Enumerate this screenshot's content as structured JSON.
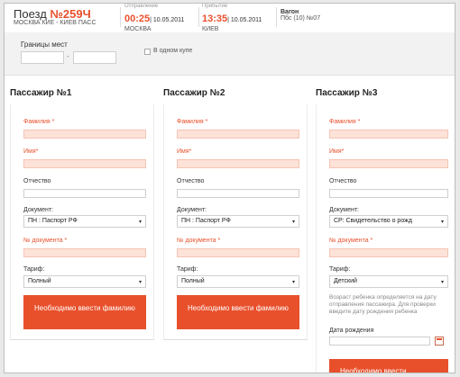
{
  "train": {
    "label": "Поезд",
    "number": "№259Ч",
    "route": "МОСКВА КИЕ - КИЕВ ПАСС"
  },
  "departure": {
    "label": "Отправление",
    "time": "00:25",
    "date": "| 10.05.2011",
    "city": "МОСКВА"
  },
  "arrival": {
    "label": "Прибытие",
    "time": "13:35",
    "date": "| 10.05.2011",
    "city": "КИЕВ"
  },
  "wagon": {
    "label": "Вагон",
    "value": "Пбс (10) №07"
  },
  "filters": {
    "seat_range_label": "Границы мест",
    "separator": "-",
    "same_compartment_label": "В одном купе"
  },
  "passengers": [
    {
      "title": "Пассажир №1",
      "surname_label": "Фамилия *",
      "name_label": "Имя*",
      "patronymic_label": "Отчество",
      "document_label": "Документ:",
      "document_value": "ПН : Паспорт РФ",
      "doc_number_label": "№ документа *",
      "tariff_label": "Тариф:",
      "tariff_value": "Полный",
      "error_text": "Необходимо ввести фамилию"
    },
    {
      "title": "Пассажир №2",
      "surname_label": "Фамилия *",
      "name_label": "Имя*",
      "patronymic_label": "Отчество",
      "document_label": "Документ:",
      "document_value": "ПН : Паспорт РФ",
      "doc_number_label": "№ документа *",
      "tariff_label": "Тариф:",
      "tariff_value": "Полный",
      "error_text": "Необходимо ввести фамилию"
    },
    {
      "title": "Пассажир №3",
      "surname_label": "Фамилия *",
      "name_label": "Имя*",
      "patronymic_label": "Отчество",
      "document_label": "Документ:",
      "document_value": "СР: Свидетельство о рожд",
      "doc_number_label": "№ документа *",
      "tariff_label": "Тариф:",
      "tariff_value": "Детский",
      "age_note": "Возраст ребенка определяется на дату отправления пассажира. Для проверки введите дату рождения ребенка",
      "birthdate_label": "Дата рождения",
      "error_text": "Необходимо ввести"
    }
  ],
  "icons": {
    "select_arrow": "▾",
    "calendar": "calendar-icon"
  },
  "colors": {
    "accent": "#e8502c",
    "field_error_bg": "#fde2d8"
  }
}
